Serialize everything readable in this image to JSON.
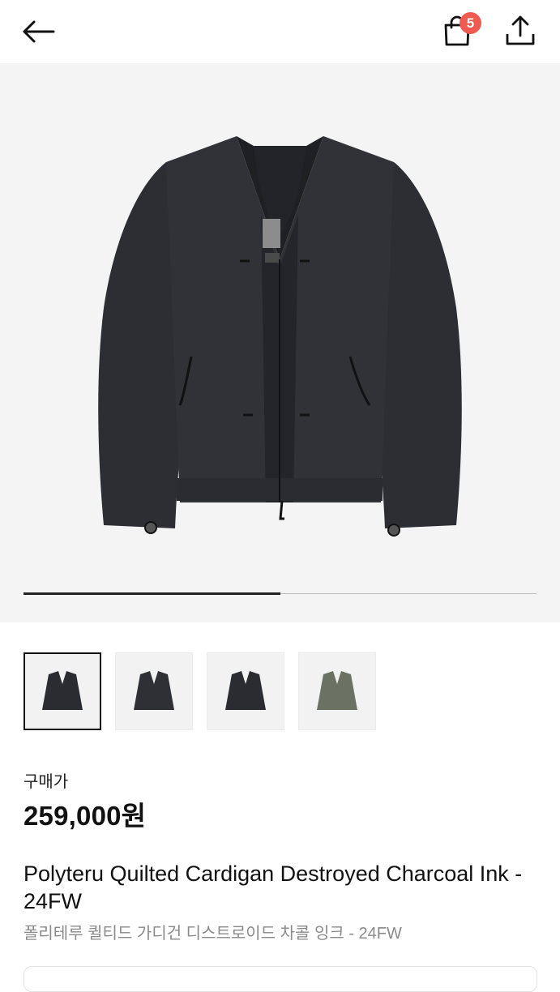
{
  "header": {
    "back_icon": "arrow-left-icon",
    "cart_icon": "shopping-bag-icon",
    "cart_count": "5",
    "share_icon": "share-upload-icon",
    "badge_color": "#ef5b50"
  },
  "gallery": {
    "background": "#f4f4f4",
    "current_index": 1,
    "total_images": 4,
    "progress_fraction": 0.5
  },
  "thumbnails": [
    {
      "color": "#2a2c31",
      "selected": true
    },
    {
      "color": "#2e3035",
      "selected": false
    },
    {
      "color": "#2a2c31",
      "selected": false
    },
    {
      "color": "#6b7264",
      "selected": false
    }
  ],
  "product": {
    "price_label": "구매가",
    "price": "259,000원",
    "title": "Polyteru Quilted Cardigan Destroyed Charcoal Ink - 24FW",
    "subtitle": "폴리테루 퀼티드 가디건 디스트로이드 차콜 잉크 - 24FW"
  }
}
